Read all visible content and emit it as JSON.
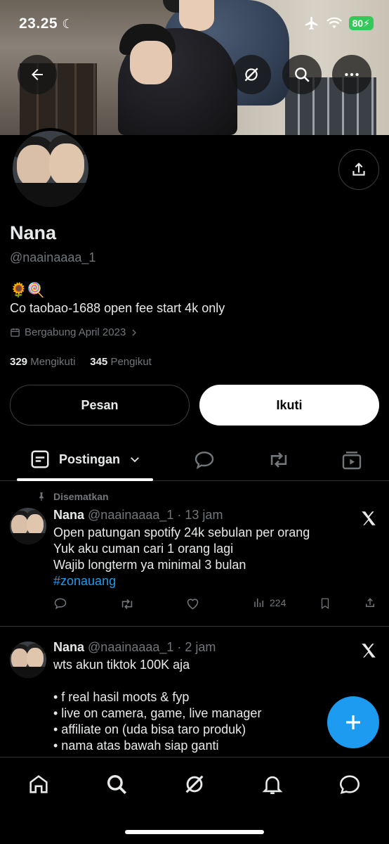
{
  "status_bar": {
    "time": "23.25",
    "battery": "80",
    "icons": [
      "moon-icon",
      "airplane-icon",
      "wifi-icon",
      "battery-charging-icon"
    ]
  },
  "header": {
    "buttons": [
      "back-arrow-icon",
      "grok-icon",
      "search-icon",
      "more-icon"
    ]
  },
  "profile": {
    "name": "Nana",
    "handle": "@naainaaaa_1",
    "emoji": "🌻🍭",
    "bio": "Co taobao-1688 open fee start 4k only",
    "joined": "Bergabung April 2023",
    "following_count": "329",
    "following_label": "Mengikuti",
    "followers_count": "345",
    "followers_label": "Pengikut",
    "message_button": "Pesan",
    "follow_button": "Ikuti"
  },
  "tabs": {
    "active_label": "Postingan",
    "icons": [
      "replies-icon",
      "reposts-icon",
      "media-icon"
    ]
  },
  "posts": [
    {
      "pinned_label": "Disematkan",
      "name": "Nana",
      "meta": "@naainaaaa_1 · 13 jam",
      "lines": [
        "Open patungan spotify 24k sebulan per orang",
        "Yuk aku cuman cari 1 orang lagi",
        "Wajib longterm ya minimal 3 bulan"
      ],
      "hashtag": "#zonauang",
      "views": "224"
    },
    {
      "name": "Nana",
      "meta": "@naainaaaa_1 · 2 jam",
      "lines": [
        "wts akun tiktok 100K aja",
        "",
        "• f real hasil moots & fyp",
        "• live on camera, game, live manager",
        "• affiliate on (uda bisa taro produk)",
        "• nama atas bawah siap ganti"
      ]
    }
  ],
  "colors": {
    "accent": "#1d9bf0",
    "muted": "#71767b",
    "text": "#e7e9ea",
    "battery": "#34c759"
  }
}
